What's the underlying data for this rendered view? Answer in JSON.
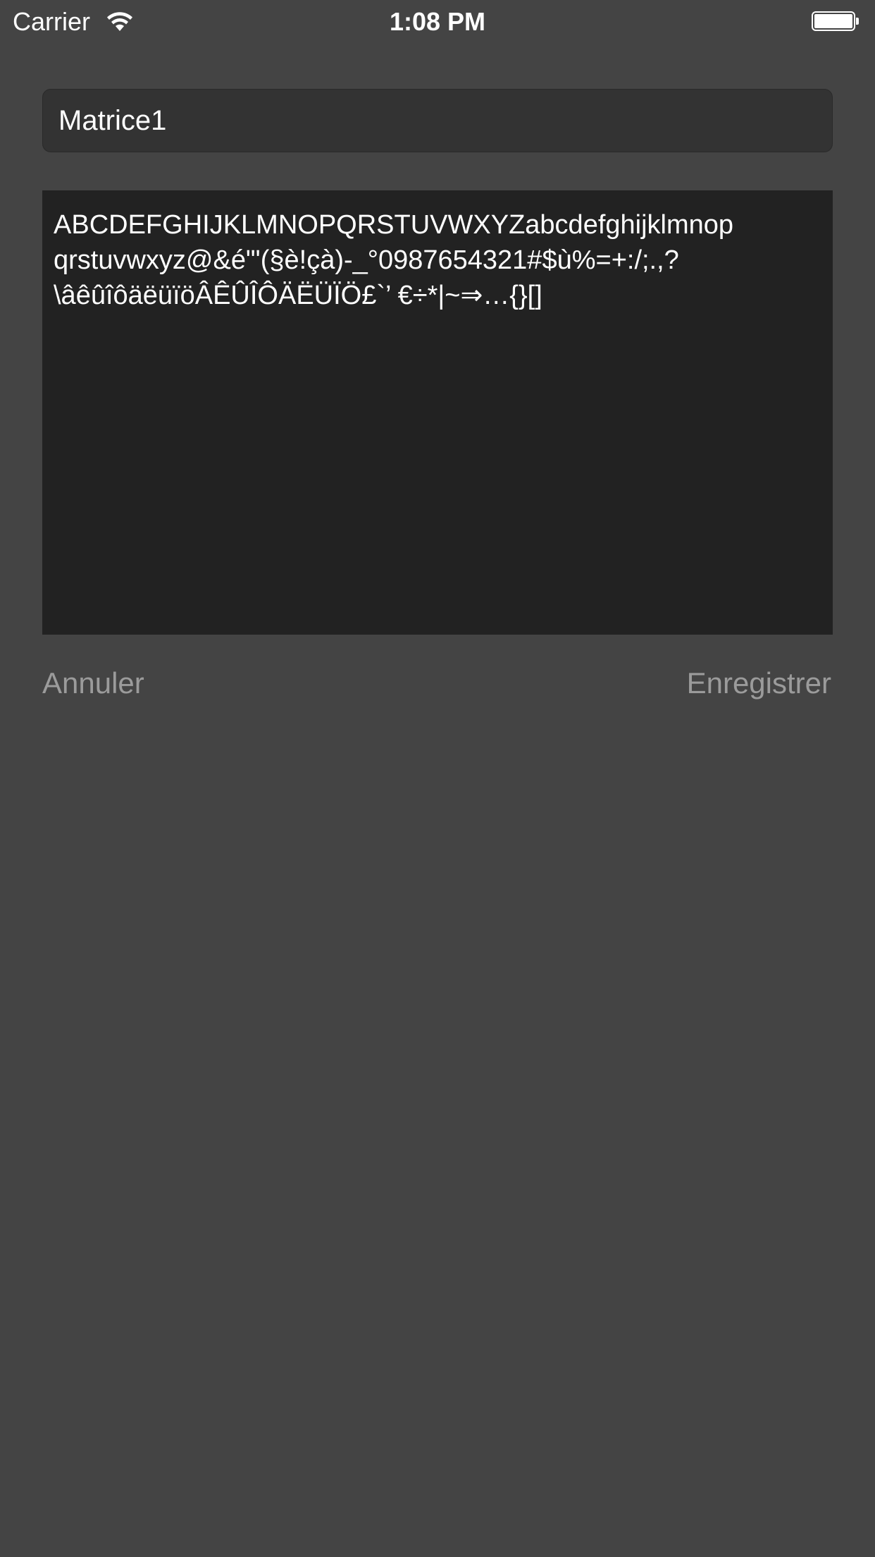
{
  "status_bar": {
    "carrier": "Carrier",
    "wifi_icon": "wifi-icon",
    "time": "1:08 PM",
    "battery_icon": "battery-icon",
    "battery_level": 1.0
  },
  "form": {
    "title_value": "Matrice1",
    "body_text": "ABCDEFGHIJKLMNOPQRSTUVWXYZabcdefghijklmnop\nqrstuvwxyz@&é\"'(§è!çà)-_°0987654321#$ù%=+:/;.,?\n\\âêûîôäëüïöÂÊÛÎÔÄËÜÏÖ£`’ €÷*|~⇒…{}[]"
  },
  "actions": {
    "cancel_label": "Annuler",
    "save_label": "Enregistrer"
  },
  "colors": {
    "background": "#444444",
    "field_background": "#333333",
    "text_area_background": "#222222",
    "button_text": "#9b9b9b"
  }
}
